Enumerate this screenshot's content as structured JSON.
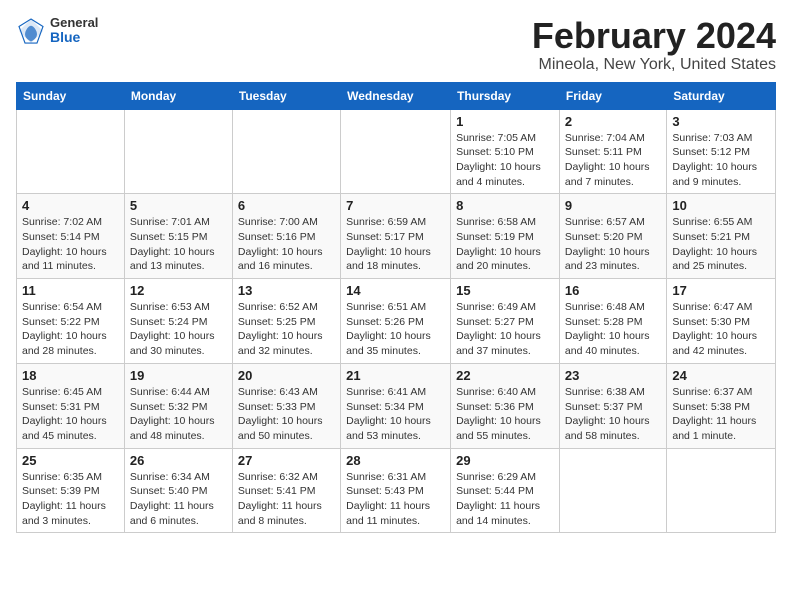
{
  "header": {
    "logo_general": "General",
    "logo_blue": "Blue",
    "title": "February 2024",
    "subtitle": "Mineola, New York, United States"
  },
  "columns": [
    "Sunday",
    "Monday",
    "Tuesday",
    "Wednesday",
    "Thursday",
    "Friday",
    "Saturday"
  ],
  "weeks": [
    [
      {
        "num": "",
        "info": ""
      },
      {
        "num": "",
        "info": ""
      },
      {
        "num": "",
        "info": ""
      },
      {
        "num": "",
        "info": ""
      },
      {
        "num": "1",
        "info": "Sunrise: 7:05 AM\nSunset: 5:10 PM\nDaylight: 10 hours\nand 4 minutes."
      },
      {
        "num": "2",
        "info": "Sunrise: 7:04 AM\nSunset: 5:11 PM\nDaylight: 10 hours\nand 7 minutes."
      },
      {
        "num": "3",
        "info": "Sunrise: 7:03 AM\nSunset: 5:12 PM\nDaylight: 10 hours\nand 9 minutes."
      }
    ],
    [
      {
        "num": "4",
        "info": "Sunrise: 7:02 AM\nSunset: 5:14 PM\nDaylight: 10 hours\nand 11 minutes."
      },
      {
        "num": "5",
        "info": "Sunrise: 7:01 AM\nSunset: 5:15 PM\nDaylight: 10 hours\nand 13 minutes."
      },
      {
        "num": "6",
        "info": "Sunrise: 7:00 AM\nSunset: 5:16 PM\nDaylight: 10 hours\nand 16 minutes."
      },
      {
        "num": "7",
        "info": "Sunrise: 6:59 AM\nSunset: 5:17 PM\nDaylight: 10 hours\nand 18 minutes."
      },
      {
        "num": "8",
        "info": "Sunrise: 6:58 AM\nSunset: 5:19 PM\nDaylight: 10 hours\nand 20 minutes."
      },
      {
        "num": "9",
        "info": "Sunrise: 6:57 AM\nSunset: 5:20 PM\nDaylight: 10 hours\nand 23 minutes."
      },
      {
        "num": "10",
        "info": "Sunrise: 6:55 AM\nSunset: 5:21 PM\nDaylight: 10 hours\nand 25 minutes."
      }
    ],
    [
      {
        "num": "11",
        "info": "Sunrise: 6:54 AM\nSunset: 5:22 PM\nDaylight: 10 hours\nand 28 minutes."
      },
      {
        "num": "12",
        "info": "Sunrise: 6:53 AM\nSunset: 5:24 PM\nDaylight: 10 hours\nand 30 minutes."
      },
      {
        "num": "13",
        "info": "Sunrise: 6:52 AM\nSunset: 5:25 PM\nDaylight: 10 hours\nand 32 minutes."
      },
      {
        "num": "14",
        "info": "Sunrise: 6:51 AM\nSunset: 5:26 PM\nDaylight: 10 hours\nand 35 minutes."
      },
      {
        "num": "15",
        "info": "Sunrise: 6:49 AM\nSunset: 5:27 PM\nDaylight: 10 hours\nand 37 minutes."
      },
      {
        "num": "16",
        "info": "Sunrise: 6:48 AM\nSunset: 5:28 PM\nDaylight: 10 hours\nand 40 minutes."
      },
      {
        "num": "17",
        "info": "Sunrise: 6:47 AM\nSunset: 5:30 PM\nDaylight: 10 hours\nand 42 minutes."
      }
    ],
    [
      {
        "num": "18",
        "info": "Sunrise: 6:45 AM\nSunset: 5:31 PM\nDaylight: 10 hours\nand 45 minutes."
      },
      {
        "num": "19",
        "info": "Sunrise: 6:44 AM\nSunset: 5:32 PM\nDaylight: 10 hours\nand 48 minutes."
      },
      {
        "num": "20",
        "info": "Sunrise: 6:43 AM\nSunset: 5:33 PM\nDaylight: 10 hours\nand 50 minutes."
      },
      {
        "num": "21",
        "info": "Sunrise: 6:41 AM\nSunset: 5:34 PM\nDaylight: 10 hours\nand 53 minutes."
      },
      {
        "num": "22",
        "info": "Sunrise: 6:40 AM\nSunset: 5:36 PM\nDaylight: 10 hours\nand 55 minutes."
      },
      {
        "num": "23",
        "info": "Sunrise: 6:38 AM\nSunset: 5:37 PM\nDaylight: 10 hours\nand 58 minutes."
      },
      {
        "num": "24",
        "info": "Sunrise: 6:37 AM\nSunset: 5:38 PM\nDaylight: 11 hours\nand 1 minute."
      }
    ],
    [
      {
        "num": "25",
        "info": "Sunrise: 6:35 AM\nSunset: 5:39 PM\nDaylight: 11 hours\nand 3 minutes."
      },
      {
        "num": "26",
        "info": "Sunrise: 6:34 AM\nSunset: 5:40 PM\nDaylight: 11 hours\nand 6 minutes."
      },
      {
        "num": "27",
        "info": "Sunrise: 6:32 AM\nSunset: 5:41 PM\nDaylight: 11 hours\nand 8 minutes."
      },
      {
        "num": "28",
        "info": "Sunrise: 6:31 AM\nSunset: 5:43 PM\nDaylight: 11 hours\nand 11 minutes."
      },
      {
        "num": "29",
        "info": "Sunrise: 6:29 AM\nSunset: 5:44 PM\nDaylight: 11 hours\nand 14 minutes."
      },
      {
        "num": "",
        "info": ""
      },
      {
        "num": "",
        "info": ""
      }
    ]
  ]
}
